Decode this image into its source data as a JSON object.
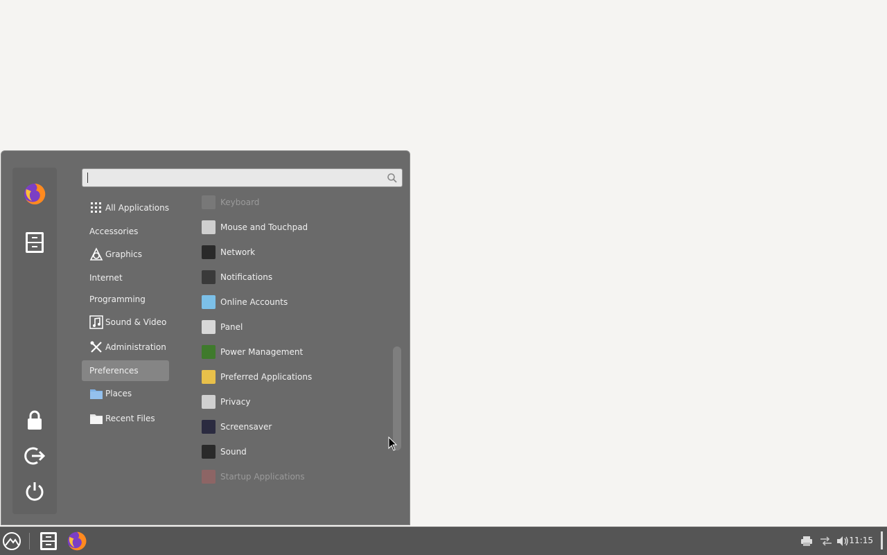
{
  "search": {
    "placeholder": ""
  },
  "favorites": [
    {
      "name": "firefox-icon"
    },
    {
      "name": "file-cabinet-icon"
    }
  ],
  "session_buttons": [
    {
      "name": "lock-icon"
    },
    {
      "name": "logout-icon"
    },
    {
      "name": "power-icon"
    }
  ],
  "categories": [
    {
      "label": "All Applications",
      "icon": "grid-icon",
      "selected": false
    },
    {
      "label": "Accessories",
      "icon": null,
      "selected": false
    },
    {
      "label": "Graphics",
      "icon": "graphics-icon",
      "selected": false
    },
    {
      "label": "Internet",
      "icon": null,
      "selected": false
    },
    {
      "label": "Programming",
      "icon": null,
      "selected": false
    },
    {
      "label": "Sound & Video",
      "icon": "sound-video-icon",
      "selected": false
    },
    {
      "label": "Administration",
      "icon": "tools-icon",
      "selected": false
    },
    {
      "label": "Preferences",
      "icon": null,
      "selected": true
    },
    {
      "label": "Places",
      "icon": "folder-icon",
      "selected": false
    },
    {
      "label": "Recent Files",
      "icon": "recent-files-icon",
      "selected": false
    }
  ],
  "apps": [
    {
      "label": "Keyboard",
      "icon": "keyboard-icon",
      "color": "#8a8a8a",
      "dim": true
    },
    {
      "label": "Mouse and Touchpad",
      "icon": "mouse-icon",
      "color": "#cfcfcf",
      "dim": false
    },
    {
      "label": "Network",
      "icon": "network-icon",
      "color": "#2a2a2a",
      "dim": false
    },
    {
      "label": "Notifications",
      "icon": "notifications-icon",
      "color": "#3a3a3a",
      "dim": false
    },
    {
      "label": "Online Accounts",
      "icon": "online-accounts-icon",
      "color": "#7cc0e8",
      "dim": false
    },
    {
      "label": "Panel",
      "icon": "panel-icon",
      "color": "#d8d8d8",
      "dim": false
    },
    {
      "label": "Power Management",
      "icon": "power-management-icon",
      "color": "#3f7a2c",
      "dim": false
    },
    {
      "label": "Preferred Applications",
      "icon": "preferred-applications-icon",
      "color": "#e8c04a",
      "dim": false
    },
    {
      "label": "Privacy",
      "icon": "privacy-icon",
      "color": "#d0d0d0",
      "dim": false
    },
    {
      "label": "Screensaver",
      "icon": "screensaver-icon",
      "color": "#2b2b40",
      "dim": false
    },
    {
      "label": "Sound",
      "icon": "sound-icon",
      "color": "#2a2a2a",
      "dim": false
    },
    {
      "label": "Startup Applications",
      "icon": "startup-applications-icon",
      "color": "#b86060",
      "dim": true
    }
  ],
  "taskbar": {
    "clock": "11:15",
    "items": [
      "menu-logo-icon",
      "file-manager-icon",
      "firefox-icon"
    ],
    "tray": [
      "printer-icon",
      "network-disconnected-icon",
      "volume-icon"
    ]
  },
  "colors": {
    "menu_bg": "#6a6a6a",
    "selected_bg": "#858585",
    "taskbar_bg": "#555555",
    "desktop_bg": "#f5f4f2"
  }
}
